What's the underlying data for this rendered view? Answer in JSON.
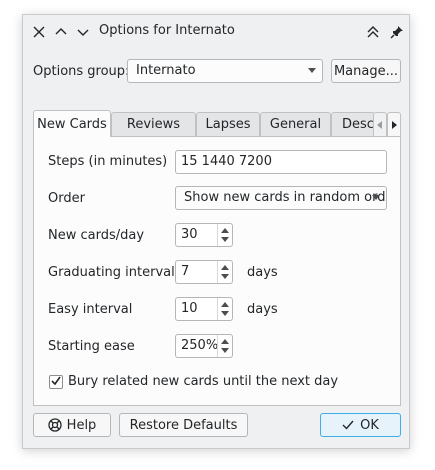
{
  "titlebar": {
    "title": "Options for Internato",
    "close_glyph": "✕",
    "up_glyph": "︿",
    "down_glyph": "﹀",
    "maximize_glyph": "⌃",
    "pin_glyph": "📌"
  },
  "options_group": {
    "label": "Options group:",
    "value": "Internato",
    "manage_label": "Manage..."
  },
  "tabs": [
    {
      "label": "New Cards",
      "active": true
    },
    {
      "label": "Reviews",
      "active": false
    },
    {
      "label": "Lapses",
      "active": false
    },
    {
      "label": "General",
      "active": false
    },
    {
      "label": "Desc",
      "active": false
    }
  ],
  "new_cards": {
    "steps_label": "Steps (in minutes)",
    "steps_value": "15 1440 7200",
    "order_label": "Order",
    "order_value": "Show new cards in random orde",
    "per_day_label": "New cards/day",
    "per_day_value": "30",
    "grad_label": "Graduating interval",
    "grad_value": "7",
    "grad_unit": "days",
    "easy_label": "Easy interval",
    "easy_value": "10",
    "easy_unit": "days",
    "ease_label": "Starting ease",
    "ease_value": "250%",
    "bury_label": "Bury related new cards until the next day",
    "bury_checked": true
  },
  "footer": {
    "help_label": "Help",
    "restore_label": "Restore Defaults",
    "ok_label": "OK"
  },
  "colors": {
    "ok_border": "#3daee9",
    "ok_bg": "#e6f3fb"
  }
}
